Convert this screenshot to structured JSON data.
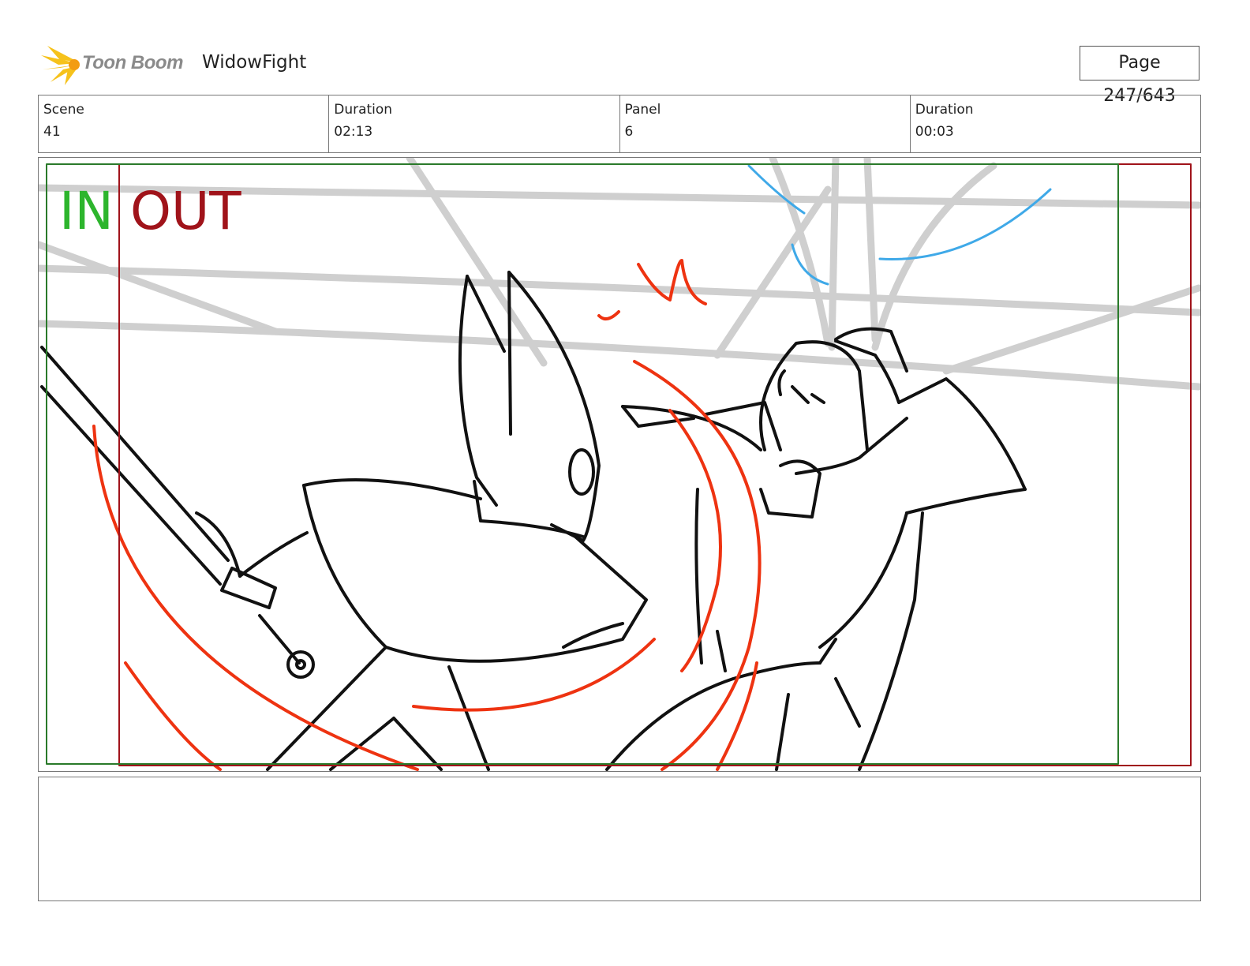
{
  "header": {
    "logo_text": "Toon Boom",
    "project_title": "WidowFight",
    "page_label": "Page 247/643"
  },
  "info": [
    {
      "label": "Scene",
      "value": "41"
    },
    {
      "label": "Duration",
      "value": "02:13"
    },
    {
      "label": "Panel",
      "value": "6"
    },
    {
      "label": "Duration",
      "value": "00:03"
    }
  ],
  "panel": {
    "in_label": "IN",
    "out_label": "OUT",
    "in_color": "#2db52d",
    "out_color": "#a0131a",
    "ink_color": "#111111",
    "motion_color": "#ee3311",
    "background_color": "#cfcfcf",
    "highlight_color": "#3fa9e8"
  },
  "notes": {
    "text": ""
  }
}
